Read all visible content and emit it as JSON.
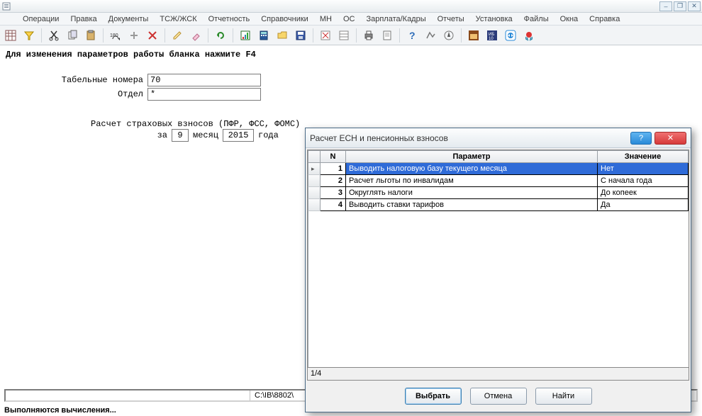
{
  "menus": [
    "Операции",
    "Правка",
    "Документы",
    "ТСЖ/ЖСК",
    "Отчетность",
    "Справочники",
    "МН",
    "ОС",
    "Зарплата/Кадры",
    "Отчеты",
    "Установка",
    "Файлы",
    "Окна",
    "Справка"
  ],
  "form": {
    "hint": "Для изменения параметров работы бланка нажмите F4",
    "tabnum_label": "Табельные номера",
    "tabnum_value": "70",
    "dept_label": "Отдел",
    "dept_value": "*",
    "calc_heading": "Расчет страховых взносов (ПФР, ФСС, ФОМС)",
    "period_prefix": "за",
    "period_month": "9",
    "period_month_word": "месяц",
    "period_year": "2015",
    "period_year_word": "года"
  },
  "status": {
    "path": "C:\\IB\\8802\\",
    "running": "Выполняются вычисления..."
  },
  "dialog": {
    "title": "Расчет ЕСН и пенсионных взносов",
    "col_n": "N",
    "col_param": "Параметр",
    "col_val": "Значение",
    "rows": [
      {
        "n": "1",
        "param": "Выводить налоговую базу текущего месяца",
        "val": "Нет"
      },
      {
        "n": "2",
        "param": "Расчет льготы по инвалидам",
        "val": "С начала года"
      },
      {
        "n": "3",
        "param": "Округлять налоги",
        "val": "До копеек"
      },
      {
        "n": "4",
        "param": "Выводить ставки тарифов",
        "val": "Да"
      }
    ],
    "pos": "1/4",
    "btn_select": "Выбрать",
    "btn_cancel": "Отмена",
    "btn_find": "Найти"
  }
}
